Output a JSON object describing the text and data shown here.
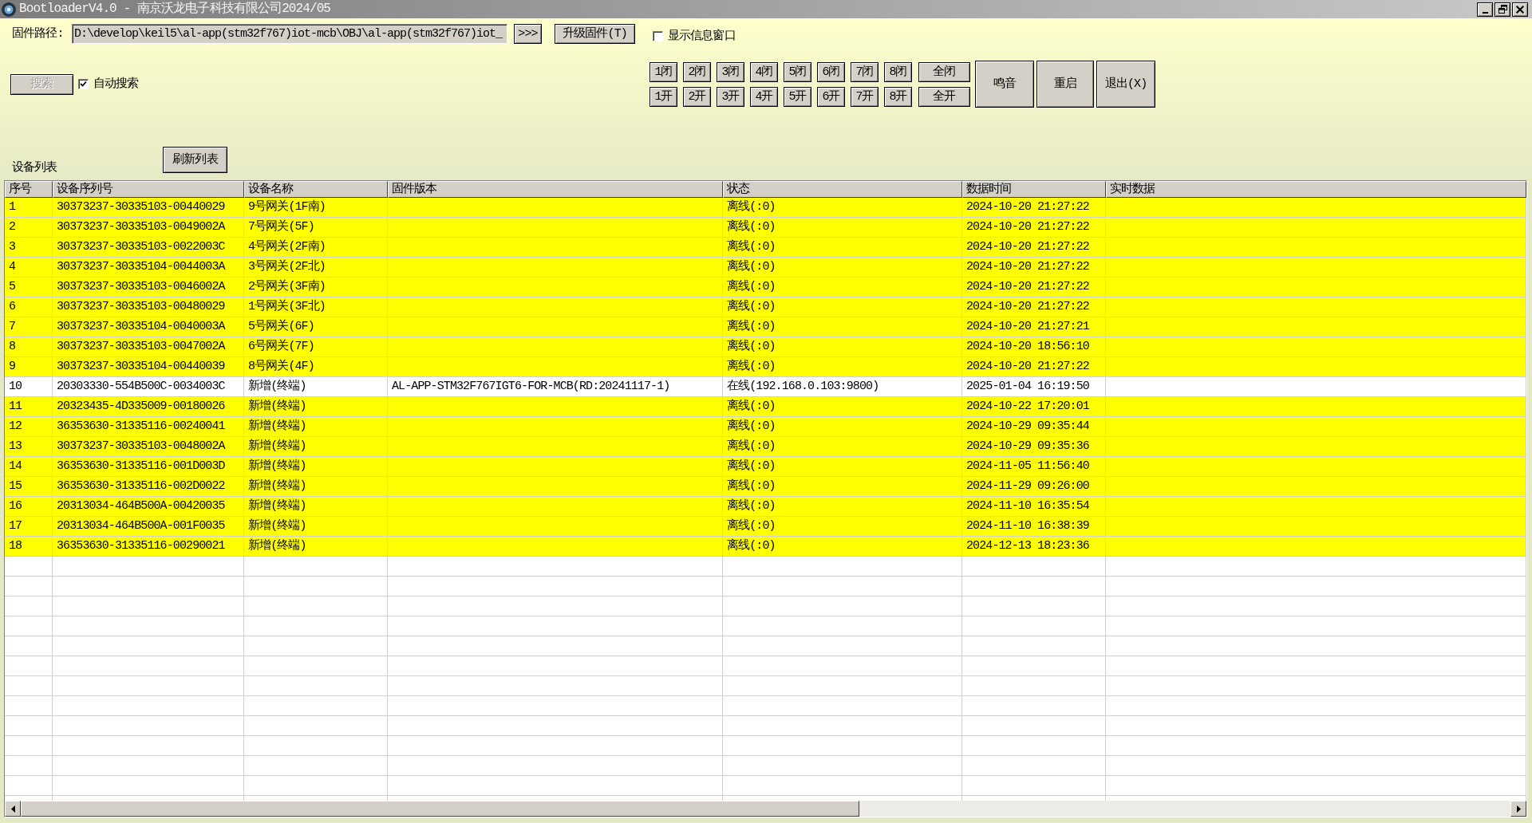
{
  "window": {
    "title": "BootloaderV4.0 - 南京沃龙电子科技有限公司2024/05"
  },
  "firmware": {
    "label": "固件路径:",
    "value": "D:\\develop\\keil5\\al-app(stm32f767)iot-mcb\\OBJ\\al-app(stm32f767)iot_",
    "browse_button": ">>>",
    "upgrade_button": "升级固件(T)"
  },
  "show_info_window": {
    "label": "显示信息窗口",
    "checked": false
  },
  "search_button": {
    "label": "搜索",
    "disabled": true
  },
  "auto_search": {
    "label": "自动搜索",
    "checked": true
  },
  "relay_buttons": [
    {
      "close": "1闭",
      "open": "1开"
    },
    {
      "close": "2闭",
      "open": "2开"
    },
    {
      "close": "3闭",
      "open": "3开"
    },
    {
      "close": "4闭",
      "open": "4开"
    },
    {
      "close": "5闭",
      "open": "5开"
    },
    {
      "close": "6闭",
      "open": "6开"
    },
    {
      "close": "7闭",
      "open": "7开"
    },
    {
      "close": "8闭",
      "open": "8开"
    }
  ],
  "all_buttons": {
    "close": "全闭",
    "open": "全开"
  },
  "action_buttons": [
    "鸣音",
    "重启",
    "退出(X)"
  ],
  "device_list": {
    "label": "设备列表",
    "refresh_button": "刷新列表"
  },
  "table": {
    "columns": [
      "序号",
      "设备序列号",
      "设备名称",
      "固件版本",
      "状态",
      "数据时间",
      "实时数据"
    ],
    "rows": [
      {
        "no": "1",
        "serial": "30373237-30335103-00440029",
        "name": "9号网关(1F南)",
        "status": "离线(:0)",
        "time": "2024-10-20 21:27:22",
        "online": false
      },
      {
        "no": "2",
        "serial": "30373237-30335103-0049002A",
        "name": "7号网关(5F)",
        "status": "离线(:0)",
        "time": "2024-10-20 21:27:22",
        "online": false
      },
      {
        "no": "3",
        "serial": "30373237-30335103-0022003C",
        "name": "4号网关(2F南)",
        "status": "离线(:0)",
        "time": "2024-10-20 21:27:22",
        "online": false
      },
      {
        "no": "4",
        "serial": "30373237-30335104-0044003A",
        "name": "3号网关(2F北)",
        "status": "离线(:0)",
        "time": "2024-10-20 21:27:22",
        "online": false
      },
      {
        "no": "5",
        "serial": "30373237-30335103-0046002A",
        "name": "2号网关(3F南)",
        "status": "离线(:0)",
        "time": "2024-10-20 21:27:22",
        "online": false
      },
      {
        "no": "6",
        "serial": "30373237-30335103-00480029",
        "name": "1号网关(3F北)",
        "status": "离线(:0)",
        "time": "2024-10-20 21:27:22",
        "online": false
      },
      {
        "no": "7",
        "serial": "30373237-30335104-0040003A",
        "name": "5号网关(6F)",
        "status": "离线(:0)",
        "time": "2024-10-20 21:27:21",
        "online": false
      },
      {
        "no": "8",
        "serial": "30373237-30335103-0047002A",
        "name": "6号网关(7F)",
        "status": "离线(:0)",
        "time": "2024-10-20 18:56:10",
        "online": false
      },
      {
        "no": "9",
        "serial": "30373237-30335104-00440039",
        "name": "8号网关(4F)",
        "status": "离线(:0)",
        "time": "2024-10-20 21:27:22",
        "online": false
      },
      {
        "no": "10",
        "serial": "20303330-554B500C-0034003C",
        "name": "新增(终端)",
        "firmware": "AL-APP-STM32F767IGT6-FOR-MCB(RD:20241117-1)",
        "status": "在线(192.168.0.103:9800)",
        "time": "2025-01-04 16:19:50",
        "online": true
      },
      {
        "no": "11",
        "serial": "20323435-4D335009-00180026",
        "name": "新增(终端)",
        "status": "离线(:0)",
        "time": "2024-10-22 17:20:01",
        "online": false
      },
      {
        "no": "12",
        "serial": "36353630-31335116-00240041",
        "name": "新增(终端)",
        "status": "离线(:0)",
        "time": "2024-10-29 09:35:44",
        "online": false
      },
      {
        "no": "13",
        "serial": "30373237-30335103-0048002A",
        "name": "新增(终端)",
        "status": "离线(:0)",
        "time": "2024-10-29 09:35:36",
        "online": false
      },
      {
        "no": "14",
        "serial": "36353630-31335116-001D003D",
        "name": "新增(终端)",
        "status": "离线(:0)",
        "time": "2024-11-05 11:56:40",
        "online": false
      },
      {
        "no": "15",
        "serial": "36353630-31335116-002D0022",
        "name": "新增(终端)",
        "status": "离线(:0)",
        "time": "2024-11-29 09:26:00",
        "online": false
      },
      {
        "no": "16",
        "serial": "20313034-464B500A-00420035",
        "name": "新增(终端)",
        "status": "离线(:0)",
        "time": "2024-11-10 16:35:54",
        "online": false
      },
      {
        "no": "17",
        "serial": "20313034-464B500A-001F0035",
        "name": "新增(终端)",
        "status": "离线(:0)",
        "time": "2024-11-10 16:38:39",
        "online": false
      },
      {
        "no": "18",
        "serial": "36353630-31335116-00290021",
        "name": "新增(终端)",
        "status": "离线(:0)",
        "time": "2024-12-13 18:23:36",
        "online": false
      }
    ]
  }
}
